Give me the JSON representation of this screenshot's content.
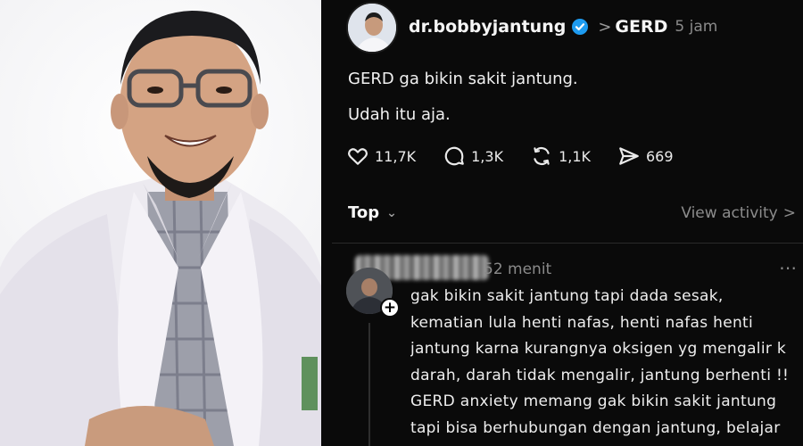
{
  "post": {
    "author": {
      "username": "dr.bobbyjantung",
      "verified": true,
      "topic": "GERD",
      "time": "5 jam"
    },
    "content": [
      "GERD ga bikin sakit jantung.",
      "Udah itu aja."
    ],
    "stats": {
      "likes": "11,7K",
      "replies": "1,3K",
      "reposts": "1,1K",
      "shares": "669"
    }
  },
  "thread": {
    "sort_label": "Top",
    "view_activity_label": "View activity",
    "reply": {
      "time": "52 menit",
      "more": "⋯",
      "follow_badge": "+",
      "lines": [
        "gak bikin sakit jantung tapi dada sesak,",
        "kematian lula henti nafas, henti nafas henti",
        "jantung karna kurangnya oksigen yg mengalir k",
        "darah, darah tidak mengalir, jantung berhenti !!",
        "GERD anxiety memang gak bikin sakit jantung",
        "tapi bisa berhubungan dengan jantung, belajar"
      ]
    }
  },
  "colors": {
    "background": "#0a0a0a",
    "text": "#f3f3f3",
    "muted": "#8a8a8a",
    "verified": "#1d9bf0"
  },
  "icons": [
    "heart-icon",
    "comment-icon",
    "repost-icon",
    "share-icon",
    "verified-badge-icon",
    "chevron-down-icon",
    "chevron-right-icon"
  ]
}
